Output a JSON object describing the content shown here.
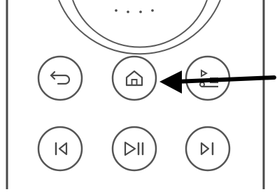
{
  "remote": {
    "top_dial": {
      "dots": 4
    },
    "buttons": [
      {
        "name": "back",
        "icon": "back-arrow-icon"
      },
      {
        "name": "home",
        "icon": "home-icon"
      },
      {
        "name": "playlist",
        "icon": "playlist-icon"
      },
      {
        "name": "previous",
        "icon": "skip-previous-icon"
      },
      {
        "name": "play-pause",
        "icon": "play-pause-icon"
      },
      {
        "name": "next",
        "icon": "skip-next-icon"
      }
    ],
    "annotation_arrow": {
      "target": "home-button",
      "color": "#000000"
    },
    "colors": {
      "outline": "#4a4a4a",
      "arrow": "#000000",
      "background": "#ffffff"
    }
  }
}
